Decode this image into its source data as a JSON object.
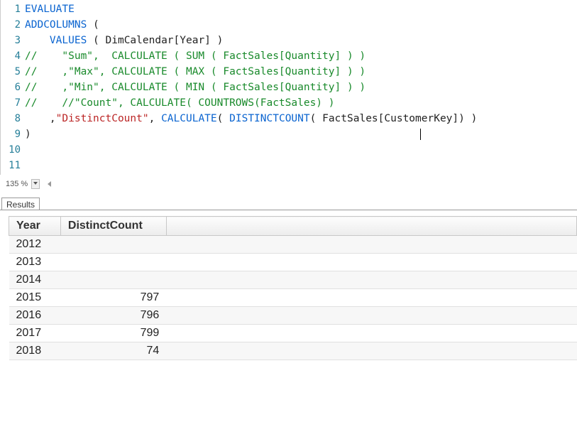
{
  "editor": {
    "zoom": "135 %",
    "lines": [
      {
        "n": "1",
        "tokens": [
          [
            "EVALUATE",
            "kw"
          ]
        ]
      },
      {
        "n": "2",
        "tokens": [
          [
            "ADDCOLUMNS",
            "kw"
          ],
          [
            " (",
            ""
          ]
        ]
      },
      {
        "n": "3",
        "tokens": [
          [
            "    ",
            ""
          ],
          [
            "VALUES",
            "kw"
          ],
          [
            " ( DimCalendar[Year] )",
            ""
          ]
        ]
      },
      {
        "n": "4",
        "tokens": [
          [
            "//    \"Sum\",  CALCULATE ( SUM ( FactSales[Quantity] ) )",
            "cmt"
          ]
        ]
      },
      {
        "n": "5",
        "tokens": [
          [
            "//    ,\"Max\", CALCULATE ( MAX ( FactSales[Quantity] ) )",
            "cmt"
          ]
        ]
      },
      {
        "n": "6",
        "tokens": [
          [
            "//    ,\"Min\", CALCULATE ( MIN ( FactSales[Quantity] ) )",
            "cmt"
          ]
        ]
      },
      {
        "n": "7",
        "tokens": [
          [
            "//    //\"Count\", CALCULATE( COUNTROWS(FactSales) )",
            "cmt"
          ]
        ]
      },
      {
        "n": "8",
        "tokens": [
          [
            "    ,",
            ""
          ],
          [
            "\"DistinctCount\"",
            "str"
          ],
          [
            ", ",
            ""
          ],
          [
            "CALCULATE",
            "kw"
          ],
          [
            "( ",
            ""
          ],
          [
            "DISTINCTCOUNT",
            "kw"
          ],
          [
            "( FactSales[CustomerKey]) )",
            ""
          ]
        ]
      },
      {
        "n": "9",
        "tokens": [
          [
            ")",
            ""
          ]
        ]
      },
      {
        "n": "10",
        "tokens": [
          [
            "",
            ""
          ]
        ]
      },
      {
        "n": "11",
        "tokens": [
          [
            "",
            ""
          ]
        ]
      }
    ]
  },
  "results": {
    "tab": "Results",
    "columns": [
      "Year",
      "DistinctCount"
    ],
    "rows": [
      {
        "Year": "2012",
        "DistinctCount": ""
      },
      {
        "Year": "2013",
        "DistinctCount": ""
      },
      {
        "Year": "2014",
        "DistinctCount": ""
      },
      {
        "Year": "2015",
        "DistinctCount": "797"
      },
      {
        "Year": "2016",
        "DistinctCount": "796"
      },
      {
        "Year": "2017",
        "DistinctCount": "799"
      },
      {
        "Year": "2018",
        "DistinctCount": "74"
      }
    ]
  },
  "chart_data": {
    "type": "table",
    "title": "",
    "columns": [
      "Year",
      "DistinctCount"
    ],
    "rows": [
      [
        "2012",
        null
      ],
      [
        "2013",
        null
      ],
      [
        "2014",
        null
      ],
      [
        "2015",
        797
      ],
      [
        "2016",
        796
      ],
      [
        "2017",
        799
      ],
      [
        "2018",
        74
      ]
    ]
  }
}
